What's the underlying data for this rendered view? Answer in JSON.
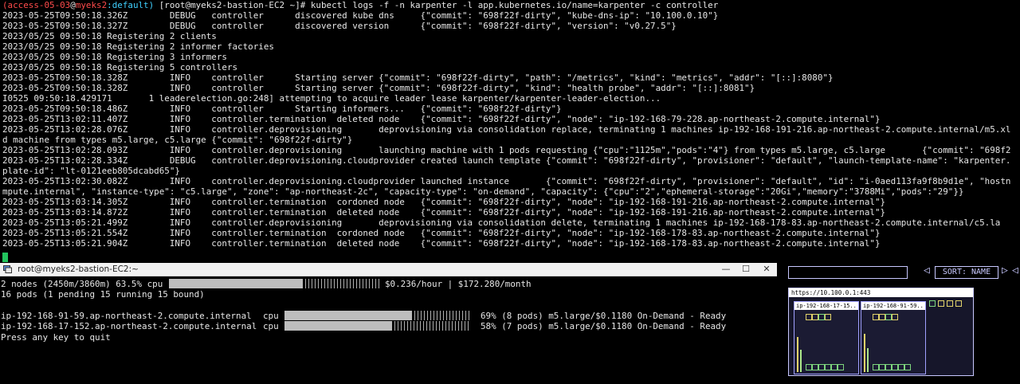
{
  "top_terminal": {
    "prompt": {
      "user": "(access-05-03",
      "at": "@",
      "host": "myeks2",
      "ctx": ":default)",
      "rest": " [root@myeks2-bastion-EC2 ~]# kubectl logs -f -n karpenter -l app.kubernetes.io/name=karpenter -c controller"
    },
    "lines": [
      "2023-05-25T09:50:18.326Z        DEBUG   controller      discovered kube dns     {\"commit\": \"698f22f-dirty\", \"kube-dns-ip\": \"10.100.0.10\"}",
      "2023-05-25T09:50:18.327Z        DEBUG   controller      discovered version      {\"commit\": \"698f22f-dirty\", \"version\": \"v0.27.5\"}",
      "2023/05/25 09:50:18 Registering 2 clients",
      "2023/05/25 09:50:18 Registering 2 informer factories",
      "2023/05/25 09:50:18 Registering 3 informers",
      "2023/05/25 09:50:18 Registering 5 controllers",
      "2023-05-25T09:50:18.328Z        INFO    controller      Starting server {\"commit\": \"698f22f-dirty\", \"path\": \"/metrics\", \"kind\": \"metrics\", \"addr\": \"[::]:8080\"}",
      "2023-05-25T09:50:18.328Z        INFO    controller      Starting server {\"commit\": \"698f22f-dirty\", \"kind\": \"health probe\", \"addr\": \"[::]:8081\"}",
      "I0525 09:50:18.429171       1 leaderelection.go:248] attempting to acquire leader lease karpenter/karpenter-leader-election...",
      "2023-05-25T09:50:18.486Z        INFO    controller      Starting informers...   {\"commit\": \"698f22f-dirty\"}",
      "2023-05-25T13:02:11.407Z        INFO    controller.termination  deleted node    {\"commit\": \"698f22f-dirty\", \"node\": \"ip-192-168-79-228.ap-northeast-2.compute.internal\"}",
      "2023-05-25T13:02:28.076Z        INFO    controller.deprovisioning       deprovisioning via consolidation replace, terminating 1 machines ip-192-168-191-216.ap-northeast-2.compute.internal/m5.xl",
      "d machine from types m5.large, c5.large {\"commit\": \"698f22f-dirty\"}",
      "2023-05-25T13:02:28.093Z        INFO    controller.deprovisioning       launching machine with 1 pods requesting {\"cpu\":\"1125m\",\"pods\":\"4\"} from types m5.large, c5.large       {\"commit\": \"698f2",
      "2023-05-25T13:02:28.334Z        DEBUG   controller.deprovisioning.cloudprovider created launch template {\"commit\": \"698f22f-dirty\", \"provisioner\": \"default\", \"launch-template-name\": \"karpenter.",
      "plate-id\": \"lt-0121eeb805dcabd65\"}",
      "2023-05-25T13:02:30.082Z        INFO    controller.deprovisioning.cloudprovider launched instance       {\"commit\": \"698f22f-dirty\", \"provisioner\": \"default\", \"id\": \"i-0aed113fa9f8b9d1e\", \"hostn",
      "mpute.internal\", \"instance-type\": \"c5.large\", \"zone\": \"ap-northeast-2c\", \"capacity-type\": \"on-demand\", \"capacity\": {\"cpu\":\"2\",\"ephemeral-storage\":\"20Gi\",\"memory\":\"3788Mi\",\"pods\":\"29\"}}",
      "2023-05-25T13:03:14.305Z        INFO    controller.termination  cordoned node   {\"commit\": \"698f22f-dirty\", \"node\": \"ip-192-168-191-216.ap-northeast-2.compute.internal\"}",
      "2023-05-25T13:03:14.872Z        INFO    controller.termination  deleted node    {\"commit\": \"698f22f-dirty\", \"node\": \"ip-192-168-191-216.ap-northeast-2.compute.internal\"}",
      "2023-05-25T13:05:21.499Z        INFO    controller.deprovisioning       deprovisioning via consolidation delete, terminating 1 machines ip-192-168-178-83.ap-northeast-2.compute.internal/c5.la",
      "2023-05-25T13:05:21.554Z        INFO    controller.termination  cordoned node   {\"commit\": \"698f22f-dirty\", \"node\": \"ip-192-168-178-83.ap-northeast-2.compute.internal\"}",
      "2023-05-25T13:05:21.904Z        INFO    controller.termination  deleted node    {\"commit\": \"698f22f-dirty\", \"node\": \"ip-192-168-178-83.ap-northeast-2.compute.internal\"}"
    ]
  },
  "window": {
    "title": "root@myeks2-bastion-EC2:~",
    "minimize": "—",
    "maximize": "☐",
    "close": "✕"
  },
  "eks_node_viewer": {
    "summary_left": "2 nodes (2450m/3860m) 63.5% cpu",
    "summary_right": "$0.236/hour | $172.280/month",
    "summary_fill": 0.635,
    "pods_line": "16 pods (1 pending 15 running 15 bound)",
    "nodes": [
      {
        "name": "ip-192-168-91-59.ap-northeast-2.compute.internal",
        "label": "cpu",
        "fill": 0.69,
        "detail": "69% (8 pods) m5.large/$0.1180 On-Demand - Ready"
      },
      {
        "name": "ip-192-168-17-152.ap-northeast-2.compute.internal",
        "label": "cpu",
        "fill": 0.58,
        "detail": "58% (7 pods) m5.large/$0.1180 On-Demand - Ready"
      }
    ],
    "footer": "Press any key to quit"
  },
  "kube_ops_view": {
    "sort_label": "SORT: NAME",
    "cluster_url": "https://10.100.0.1:443",
    "node_labels": [
      "ip-192-168-17-15..",
      "ip-192-168-91-59.."
    ],
    "colors": {
      "accent": "#c8c8ff",
      "pod_yellow": "#e2d36a",
      "pod_green": "#7ed67e"
    }
  }
}
